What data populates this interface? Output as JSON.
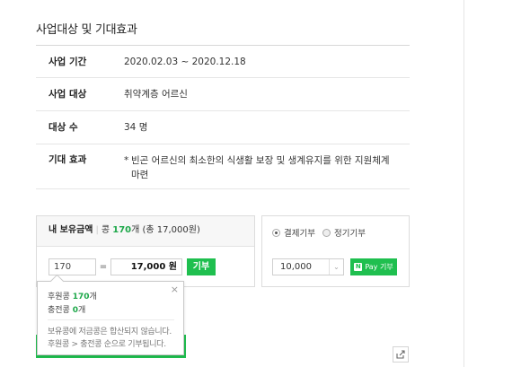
{
  "section": {
    "title": "사업대상 및 기대효과"
  },
  "info": {
    "period_label": "사업 기간",
    "period_value": "2020.02.03 ~ 2020.12.18",
    "target_label": "사업 대상",
    "target_value": "취약계층 어르신",
    "count_label": "대상 수",
    "count_value": "34 명",
    "effect_label": "기대 효과",
    "effect_bullet": "*",
    "effect_value": "빈곤 어르신의 최소한의 식생활 보장 및 생계유지를 위한 지원체계 마련"
  },
  "bean": {
    "header_label": "내 보유금액",
    "bean_prefix": "콩",
    "bean_count": "170",
    "bean_suffix": "개 (총 17,000원)",
    "input_count": "170",
    "equals": "=",
    "input_amount": "17,000 원",
    "give_label": "기부"
  },
  "payment": {
    "option_one": "결제기부",
    "option_two": "정기기부",
    "amount": "10,000",
    "pay_logo": "N",
    "pay_label": "Pay 기부"
  },
  "tooltip": {
    "close": "×",
    "donated_label": "후원콩",
    "donated_count": "170",
    "donated_unit": "개",
    "charged_label": "충전콩",
    "charged_count": "0",
    "charged_unit": "개",
    "note_line1": "보유콩에 저금콩은 합산되지 않습니다.",
    "note_line2": "후원콩 > 충전콩 순으로 기부됩니다."
  },
  "icons": {
    "share": "share-icon",
    "radio": "radio-icon",
    "dropdown": "chevron-down-icon"
  },
  "colors": {
    "accent_green": "#1fbf4f",
    "text_green": "#1ea84a"
  }
}
